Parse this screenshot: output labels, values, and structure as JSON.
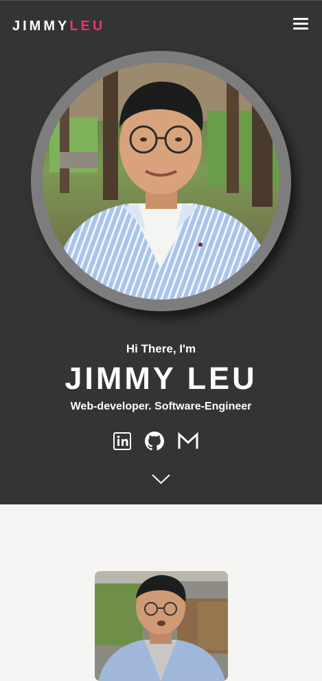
{
  "header": {
    "logo_first": "JIMMY",
    "logo_second": "LEU",
    "menu_icon": "hamburger-menu-icon"
  },
  "hero": {
    "greeting": "Hi There, I'm",
    "name": "JIMMY LEU",
    "tagline": "Web-developer. Software-Engineer",
    "socials": [
      {
        "name": "linkedin",
        "icon": "linkedin-icon"
      },
      {
        "name": "github",
        "icon": "github-icon"
      },
      {
        "name": "gmail",
        "icon": "gmail-icon"
      }
    ],
    "scroll_icon": "chevron-down-icon"
  },
  "colors": {
    "hero_bg": "#343434",
    "accent": "#e8366a",
    "ring": "#7d7d7d",
    "page_bg": "#f7f5f3"
  }
}
